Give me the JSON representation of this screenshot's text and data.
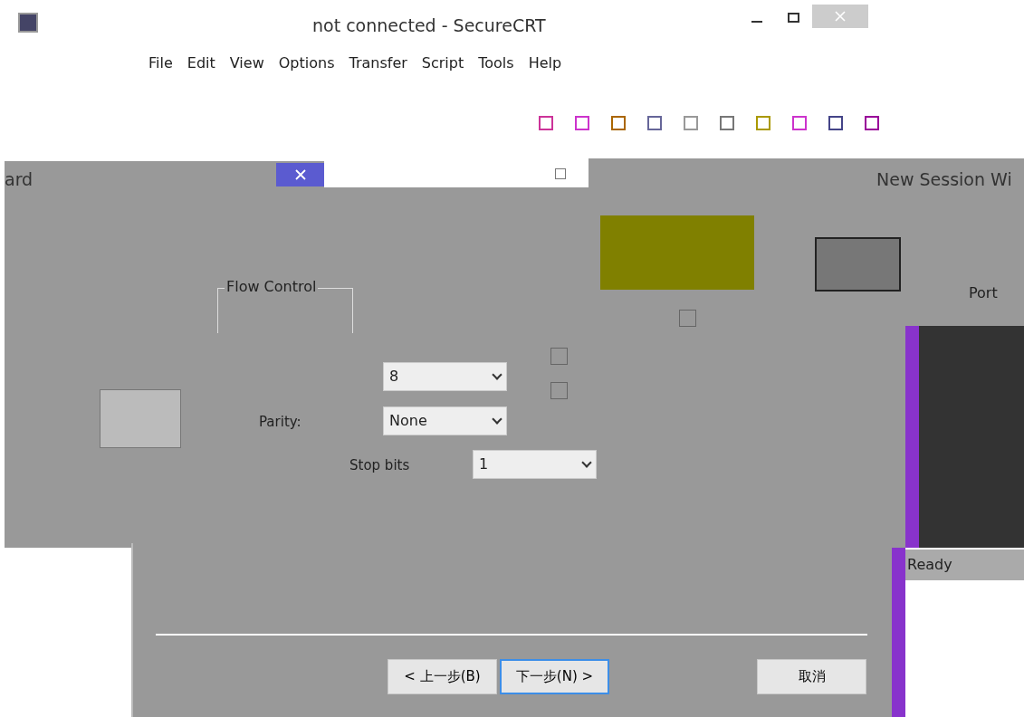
{
  "window": {
    "title": "not connected - SecureCRT"
  },
  "menu": [
    "File",
    "Edit",
    "View",
    "Options",
    "Transfer",
    "Script",
    "Tools",
    "Help"
  ],
  "wizard_behind": {
    "title": "ard"
  },
  "session_wizard": {
    "title": "New Session Wi",
    "port_label": "Port",
    "status": "Ready"
  },
  "dialog": {
    "group_title": "Flow Control",
    "fields": [
      {
        "value": "8"
      },
      {
        "label": "Parity:",
        "value": "None"
      },
      {
        "label": "Stop bits",
        "value": "1"
      }
    ],
    "checkboxes": [
      {
        "checked": false
      },
      {
        "checked": false
      },
      {
        "checked": false
      }
    ],
    "buttons": [
      {
        "label": "< 上一步(B)",
        "default": false
      },
      {
        "label": "下一步(N) >",
        "default": true
      },
      {
        "label": "取消",
        "default": false
      }
    ]
  }
}
